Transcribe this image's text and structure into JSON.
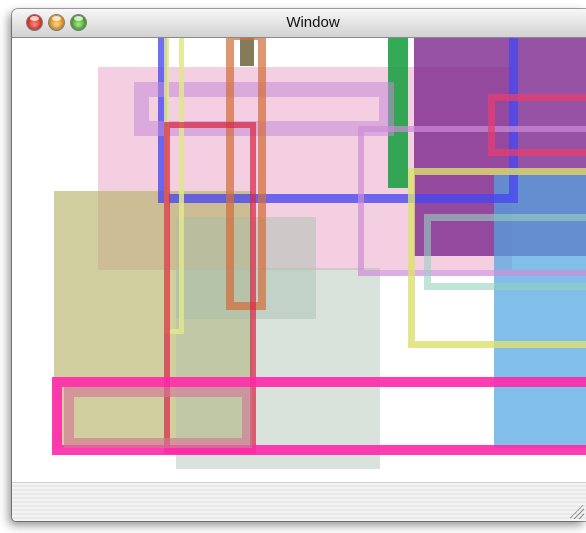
{
  "window": {
    "title": "Window"
  },
  "colors": {
    "pink_fill": "#eeb6cf",
    "khaki_fill": "#bdbb74",
    "sage_fill": "#b6c7bb",
    "sky_fill": "#5fa9e0",
    "purple_fill": "#873b9b",
    "green_bar": "#2aa64c",
    "magenta_outline": "#ff2aa8",
    "blue_outline": "#4d4df2",
    "orange_outline": "#d8773b",
    "yellow_outline": "#dbe07a",
    "red_outline": "#e0304b",
    "mint_outline": "#a8d8c6",
    "lavender_outline": "#cc8fd6"
  }
}
